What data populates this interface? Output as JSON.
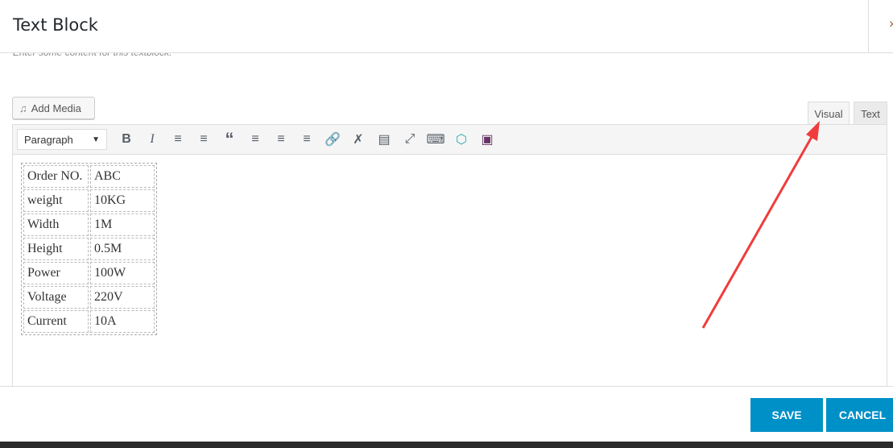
{
  "header": {
    "title": "Text Block",
    "close": "×"
  },
  "hint": "Enter some content for this textblock.",
  "add_media": "Add Media",
  "tabs": {
    "visual": "Visual",
    "text": "Text"
  },
  "toolbar": {
    "format": "Paragraph",
    "icons": [
      "bold-icon",
      "italic-icon",
      "bulleted-list-icon",
      "numbered-list-icon",
      "blockquote-icon",
      "align-left-icon",
      "align-center-icon",
      "align-right-icon",
      "link-icon",
      "unlink-icon",
      "read-more-icon",
      "fullscreen-icon",
      "toolbar-toggle-icon",
      "layers-icon",
      "gallery-icon"
    ]
  },
  "table": [
    [
      "Order NO.",
      "ABC"
    ],
    [
      "weight",
      "10KG"
    ],
    [
      "Width",
      "1M"
    ],
    [
      "Height",
      "0.5M"
    ],
    [
      "Power",
      "100W"
    ],
    [
      "Voltage",
      "220V"
    ],
    [
      "Current",
      "10A"
    ]
  ],
  "footer": {
    "save": "SAVE",
    "cancel": "CANCEL"
  },
  "colors": {
    "accent": "#0090c8",
    "annotation": "#f03c3c"
  }
}
